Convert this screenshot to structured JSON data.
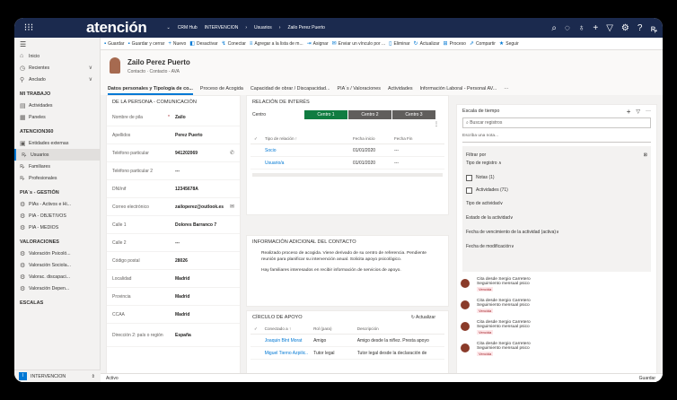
{
  "app": {
    "logo": "atención",
    "module": "CRM Hub",
    "env": "INTERVENCION",
    "crumb1": "Usuarios",
    "crumb2": "Zailo Perez Puerto"
  },
  "topbar_icons": [
    "search-icon",
    "lightbulb-icon",
    "location-icon",
    "plus-icon",
    "filter-icon",
    "gear-icon",
    "help-icon",
    "user-icon"
  ],
  "sidebar": {
    "top": [
      {
        "icon": "home-icon",
        "label": "Inicio",
        "chev": ""
      },
      {
        "icon": "clock-icon",
        "label": "Recientes",
        "chev": "∨"
      },
      {
        "icon": "pin-icon",
        "label": "Anclado",
        "chev": "∨"
      }
    ],
    "sections": [
      {
        "title": "MI TRABAJO",
        "items": [
          {
            "icon": "activity-icon",
            "label": "Actividades"
          },
          {
            "icon": "dashboard-icon",
            "label": "Paneles"
          }
        ]
      },
      {
        "title": "ATENCION360",
        "items": [
          {
            "icon": "entity-icon",
            "label": "Entidades externas"
          },
          {
            "icon": "user-icon",
            "label": "Usuarios",
            "active": true
          },
          {
            "icon": "family-icon",
            "label": "Familiares"
          },
          {
            "icon": "professional-icon",
            "label": "Profesionales"
          }
        ]
      },
      {
        "title": "PIA´s - GESTIÓN",
        "items": [
          {
            "icon": "gear-icon",
            "label": "PIAs - Activos e Hi..."
          },
          {
            "icon": "gear-icon",
            "label": "PIA - OBJETIVOS"
          },
          {
            "icon": "gear-icon",
            "label": "PIA - MEDIOS"
          }
        ]
      },
      {
        "title": "VALORACIONES",
        "items": [
          {
            "icon": "gear-icon",
            "label": "Valoración Psicoló..."
          },
          {
            "icon": "gear-icon",
            "label": "Valoración Sociola..."
          },
          {
            "icon": "gear-icon",
            "label": "Valorac. discapaci..."
          },
          {
            "icon": "gear-icon",
            "label": "Valoración Depen..."
          }
        ]
      },
      {
        "title": "ESCALAS",
        "items": []
      }
    ],
    "bottom": {
      "badge": "I",
      "label": "INTERVENCION"
    }
  },
  "commands": [
    {
      "icon": "save-icon",
      "label": "Guardar"
    },
    {
      "icon": "save-close-icon",
      "label": "Guardar y cerrar"
    },
    {
      "icon": "plus-icon",
      "label": "Nuevo"
    },
    {
      "icon": "deactivate-icon",
      "label": "Desactivar"
    },
    {
      "icon": "connect-icon",
      "label": "Conectar"
    },
    {
      "icon": "list-icon",
      "label": "Agregar a la lista de m..."
    },
    {
      "icon": "assign-icon",
      "label": "Asignar"
    },
    {
      "icon": "mail-icon",
      "label": "Enviar un vínculo por ..."
    },
    {
      "icon": "delete-icon",
      "label": "Eliminar"
    },
    {
      "icon": "refresh-icon",
      "label": "Actualizar"
    },
    {
      "icon": "process-icon",
      "label": "Proceso"
    },
    {
      "icon": "share-icon",
      "label": "Compartir"
    },
    {
      "icon": "follow-icon",
      "label": "Seguir"
    }
  ],
  "contact": {
    "name": "Zailo Perez Puerto",
    "sub": "Contacto · Contacto - AVA"
  },
  "tabs": [
    "Datos personales y Tipología de co...",
    "Proceso de Acogida",
    "Capacidad de obrar / Discapacidad...",
    "PIA´s / Valoraciones",
    "Actividades",
    "Información Laboral - Personal AV...",
    "···"
  ],
  "person": {
    "title": "DE LA PERSONA - COMUNICACIÓN",
    "fields": [
      {
        "label": "Nombre de pila",
        "req": "*",
        "value": "Zailo",
        "icon": ""
      },
      {
        "label": "Apellidos",
        "req": "",
        "value": "Perez Puerto",
        "icon": ""
      },
      {
        "label": "Teléfono particular",
        "req": "",
        "value": "941202069",
        "icon": "phone-icon"
      },
      {
        "label": "Teléfono particular 2",
        "req": "",
        "value": "---",
        "icon": ""
      },
      {
        "label": "DNI/nif",
        "req": "",
        "value": "12345678A",
        "icon": ""
      },
      {
        "label": "Correo electrónico",
        "req": "",
        "value": "zailoperez@outlook.es",
        "icon": "mail-icon"
      },
      {
        "label": "Calle 1",
        "req": "",
        "value": "Dolores Barranco 7",
        "icon": ""
      },
      {
        "label": "Calle 2",
        "req": "",
        "value": "---",
        "icon": ""
      },
      {
        "label": "Código postal",
        "req": "",
        "value": "28026",
        "icon": ""
      },
      {
        "label": "Localidad",
        "req": "",
        "value": "Madrid",
        "icon": ""
      },
      {
        "label": "Provincia",
        "req": "",
        "value": "Madrid",
        "icon": ""
      },
      {
        "label": "CCAA",
        "req": "",
        "value": "Madrid",
        "icon": ""
      },
      {
        "label": "Dirección 2: país o región",
        "req": "",
        "value": "España",
        "icon": ""
      }
    ]
  },
  "relacion": {
    "title": "RELACIÓN DE INTERÉS",
    "centro_label": "Centro",
    "segments": [
      {
        "label": "Centro 1",
        "color": "#107c41"
      },
      {
        "label": "Centro 2",
        "color": "#605e5c"
      },
      {
        "label": "Centro 3",
        "color": "#605e5c"
      }
    ],
    "cols": [
      "Tipo de relación ↑",
      "Fecha inicio",
      "Fecha Fin"
    ],
    "rows": [
      [
        "Socio",
        "01/01/2020",
        "---"
      ],
      [
        "Usuario/a",
        "01/01/2020",
        "---"
      ]
    ]
  },
  "info": {
    "title": "INFORMACIÓN ADICIONAL DEL CONTACTO",
    "p1": "Realizado proceso de acogida. Viene derivado de su centro de referencia. Pendiente reunión para planificar su intervención anual. Solicita apoyo psicológico.",
    "p2": "Hay familiares interesados en recibir información de servicios de apoyo."
  },
  "circulo": {
    "title": "CÍRCULO DE APOYO",
    "refresh": "Actualizar",
    "cols": [
      "Conectado a ↑",
      "Rol (para)",
      "Descripción"
    ],
    "rows": [
      [
        "Joaquin Blnt Morat",
        "Amigo",
        "Amigo desde la niñez. Presta apoyo"
      ],
      [
        "Miguel Tierno Azpilic..",
        "Tutor legal",
        "Tutor legal desde la declaración de"
      ]
    ]
  },
  "timeline": {
    "title": "Escala de tiempo",
    "search": "Buscar registros",
    "note": "Escriba una nota...",
    "filter_title": "Filtrar por",
    "reg_label": "Tipo de registro",
    "checks": [
      "Notas (1)",
      "Actividades (71)"
    ],
    "filters": [
      "Tipo de actividad",
      "Estado de la actividad",
      "Fecha de vencimiento de la actividad (activa)",
      "Fecha de modificación"
    ],
    "items": [
      {
        "title": "Cita desde Sergio Carretero",
        "sub": "Seguimiento mensual psico",
        "tag": "Vencida"
      },
      {
        "title": "Cita desde Sergio Carretero",
        "sub": "Seguimiento mensual psico",
        "tag": "Vencida"
      },
      {
        "title": "Cita desde Sergio Carretero",
        "sub": "Seguimiento mensual psico",
        "tag": "Vencida"
      },
      {
        "title": "Cita desde Sergio Carretero",
        "sub": "Seguimiento mensual psico",
        "tag": "Vencida"
      }
    ]
  },
  "status": {
    "left": "Activo",
    "right": "Guardar"
  }
}
